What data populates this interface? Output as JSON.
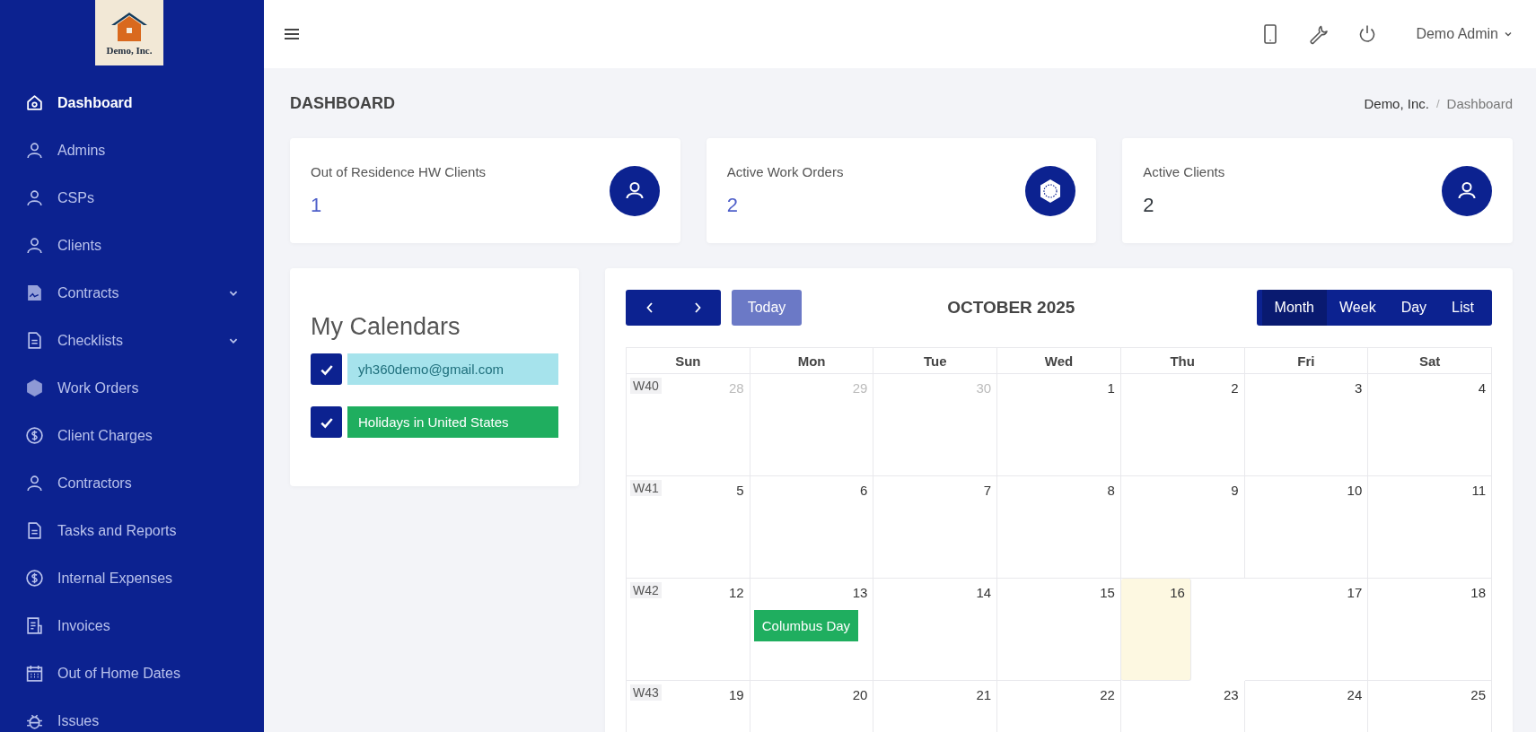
{
  "logo": {
    "text": "Demo, Inc."
  },
  "sidebar": {
    "items": [
      {
        "label": "Dashboard",
        "selected": true,
        "has_submenu": false
      },
      {
        "label": "Admins",
        "selected": false,
        "has_submenu": false
      },
      {
        "label": "CSPs",
        "selected": false,
        "has_submenu": false
      },
      {
        "label": "Clients",
        "selected": false,
        "has_submenu": false
      },
      {
        "label": "Contracts",
        "selected": false,
        "has_submenu": true
      },
      {
        "label": "Checklists",
        "selected": false,
        "has_submenu": true
      },
      {
        "label": "Work Orders",
        "selected": false,
        "has_submenu": false
      },
      {
        "label": "Client Charges",
        "selected": false,
        "has_submenu": false
      },
      {
        "label": "Contractors",
        "selected": false,
        "has_submenu": false
      },
      {
        "label": "Tasks and Reports",
        "selected": false,
        "has_submenu": false
      },
      {
        "label": "Internal Expenses",
        "selected": false,
        "has_submenu": false
      },
      {
        "label": "Invoices",
        "selected": false,
        "has_submenu": false
      },
      {
        "label": "Out of Home Dates",
        "selected": false,
        "has_submenu": false
      },
      {
        "label": "Issues",
        "selected": false,
        "has_submenu": false
      }
    ]
  },
  "topbar": {
    "user": "Demo Admin"
  },
  "page": {
    "title": "DASHBOARD",
    "breadcrumb": [
      "Demo, Inc.",
      "Dashboard"
    ],
    "breadcrumb_separator": "/"
  },
  "stats": [
    {
      "label": "Out of Residence HW Clients",
      "value": "1",
      "color": "#4e5fc9"
    },
    {
      "label": "Active Work Orders",
      "value": "2",
      "color": "#4e5fc9"
    },
    {
      "label": "Active Clients",
      "value": "2",
      "color": "#343a40"
    }
  ],
  "my_calendars": {
    "title": "My Calendars",
    "items": [
      {
        "label": "yh360demo@gmail.com",
        "checked": true,
        "color": "#a6e3ec"
      },
      {
        "label": "Holidays in United States",
        "checked": true,
        "color": "#1fae5f"
      }
    ]
  },
  "calendar": {
    "title": "OCTOBER 2025",
    "today_button": "Today",
    "views": [
      {
        "label": "Month",
        "selected": true
      },
      {
        "label": "Week",
        "selected": false
      },
      {
        "label": "Day",
        "selected": false
      },
      {
        "label": "List",
        "selected": false
      }
    ],
    "weekdays": [
      "Sun",
      "Mon",
      "Tue",
      "Wed",
      "Thu",
      "Fri",
      "Sat"
    ],
    "weeks": [
      {
        "label": "W40",
        "days": [
          {
            "date": "28",
            "other_month": true,
            "today": false
          },
          {
            "date": "29",
            "other_month": true,
            "today": false
          },
          {
            "date": "30",
            "other_month": true,
            "today": false
          },
          {
            "date": "1",
            "other_month": false,
            "today": false
          },
          {
            "date": "2",
            "other_month": false,
            "today": false
          },
          {
            "date": "3",
            "other_month": false,
            "today": false
          },
          {
            "date": "4",
            "other_month": false,
            "today": false
          }
        ]
      },
      {
        "label": "W41",
        "days": [
          {
            "date": "5",
            "other_month": false,
            "today": false
          },
          {
            "date": "6",
            "other_month": false,
            "today": false
          },
          {
            "date": "7",
            "other_month": false,
            "today": false
          },
          {
            "date": "8",
            "other_month": false,
            "today": false
          },
          {
            "date": "9",
            "other_month": false,
            "today": false
          },
          {
            "date": "10",
            "other_month": false,
            "today": false
          },
          {
            "date": "11",
            "other_month": false,
            "today": false
          }
        ]
      },
      {
        "label": "W42",
        "days": [
          {
            "date": "12",
            "other_month": false,
            "today": false
          },
          {
            "date": "13",
            "other_month": false,
            "today": false,
            "events": [
              {
                "title": "Columbus Day",
                "color": "#1fae5f"
              }
            ]
          },
          {
            "date": "14",
            "other_month": false,
            "today": false
          },
          {
            "date": "15",
            "other_month": false,
            "today": false
          },
          {
            "date": "16",
            "other_month": false,
            "today": true
          },
          {
            "date": "17",
            "other_month": false,
            "today": false
          },
          {
            "date": "18",
            "other_month": false,
            "today": false
          }
        ]
      },
      {
        "label": "W43",
        "days": [
          {
            "date": "19",
            "other_month": false,
            "today": false
          },
          {
            "date": "20",
            "other_month": false,
            "today": false
          },
          {
            "date": "21",
            "other_month": false,
            "today": false
          },
          {
            "date": "22",
            "other_month": false,
            "today": false
          },
          {
            "date": "23",
            "other_month": false,
            "today": false
          },
          {
            "date": "24",
            "other_month": false,
            "today": false
          },
          {
            "date": "25",
            "other_month": false,
            "today": false
          }
        ]
      }
    ]
  }
}
